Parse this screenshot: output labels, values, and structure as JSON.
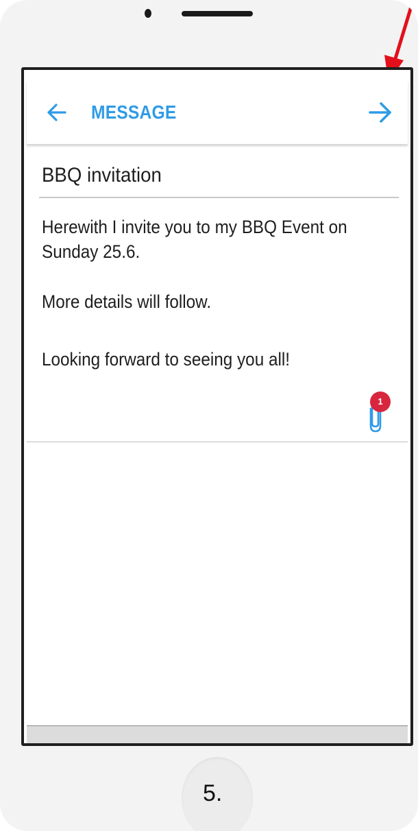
{
  "header": {
    "title": "MESSAGE",
    "accent_color": "#2f9be6"
  },
  "message": {
    "subject": "BBQ invitation",
    "body_lines": [
      "Herewith I invite you to my BBQ Event on",
      "Sunday 25.6.",
      "More details will follow.",
      "Looking forward to seeing you all!"
    ],
    "attachment_count": "1",
    "badge_color": "#d7263d"
  },
  "icons": {
    "back": "arrow-left-icon",
    "forward": "arrow-right-icon",
    "attachment": "paperclip-icon",
    "annotation": "red-arrow-pointer-icon"
  },
  "annotation": {
    "arrow_color": "#e3101c"
  },
  "footer": {
    "step_label": "5."
  }
}
